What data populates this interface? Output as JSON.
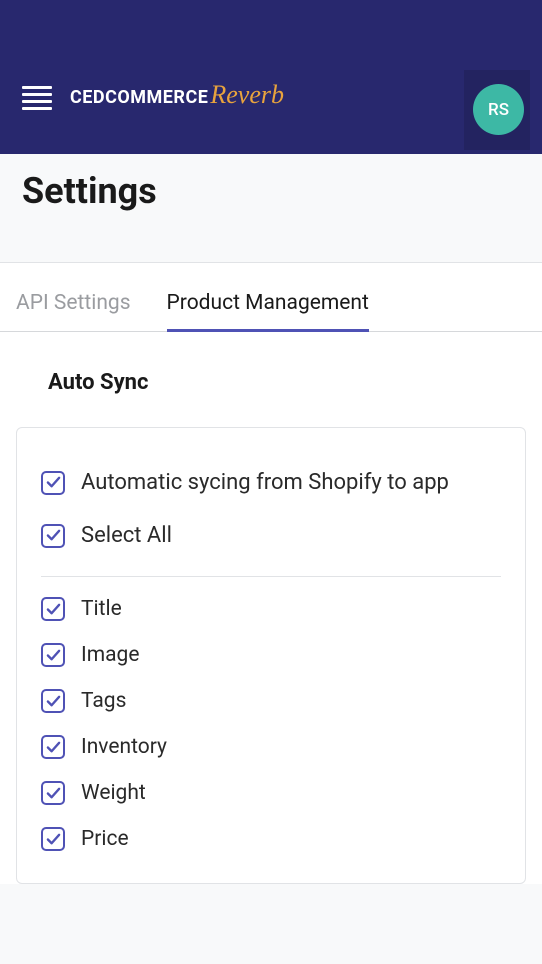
{
  "header": {
    "logo_main": "CEDCOMMERCE",
    "logo_sub": "Reverb",
    "avatar": "RS"
  },
  "page": {
    "title": "Settings"
  },
  "tabs": [
    {
      "label": "API Settings",
      "active": false
    },
    {
      "label": "Product Management",
      "active": true
    }
  ],
  "section": {
    "title": "Auto Sync"
  },
  "checkboxes": {
    "auto_sync": {
      "label": "Automatic sycing from Shopify to app",
      "checked": true
    },
    "select_all": {
      "label": "Select All",
      "checked": true
    },
    "options": [
      {
        "label": "Title",
        "checked": true
      },
      {
        "label": "Image",
        "checked": true
      },
      {
        "label": "Tags",
        "checked": true
      },
      {
        "label": "Inventory",
        "checked": true
      },
      {
        "label": "Weight",
        "checked": true
      },
      {
        "label": "Price",
        "checked": true
      }
    ]
  }
}
